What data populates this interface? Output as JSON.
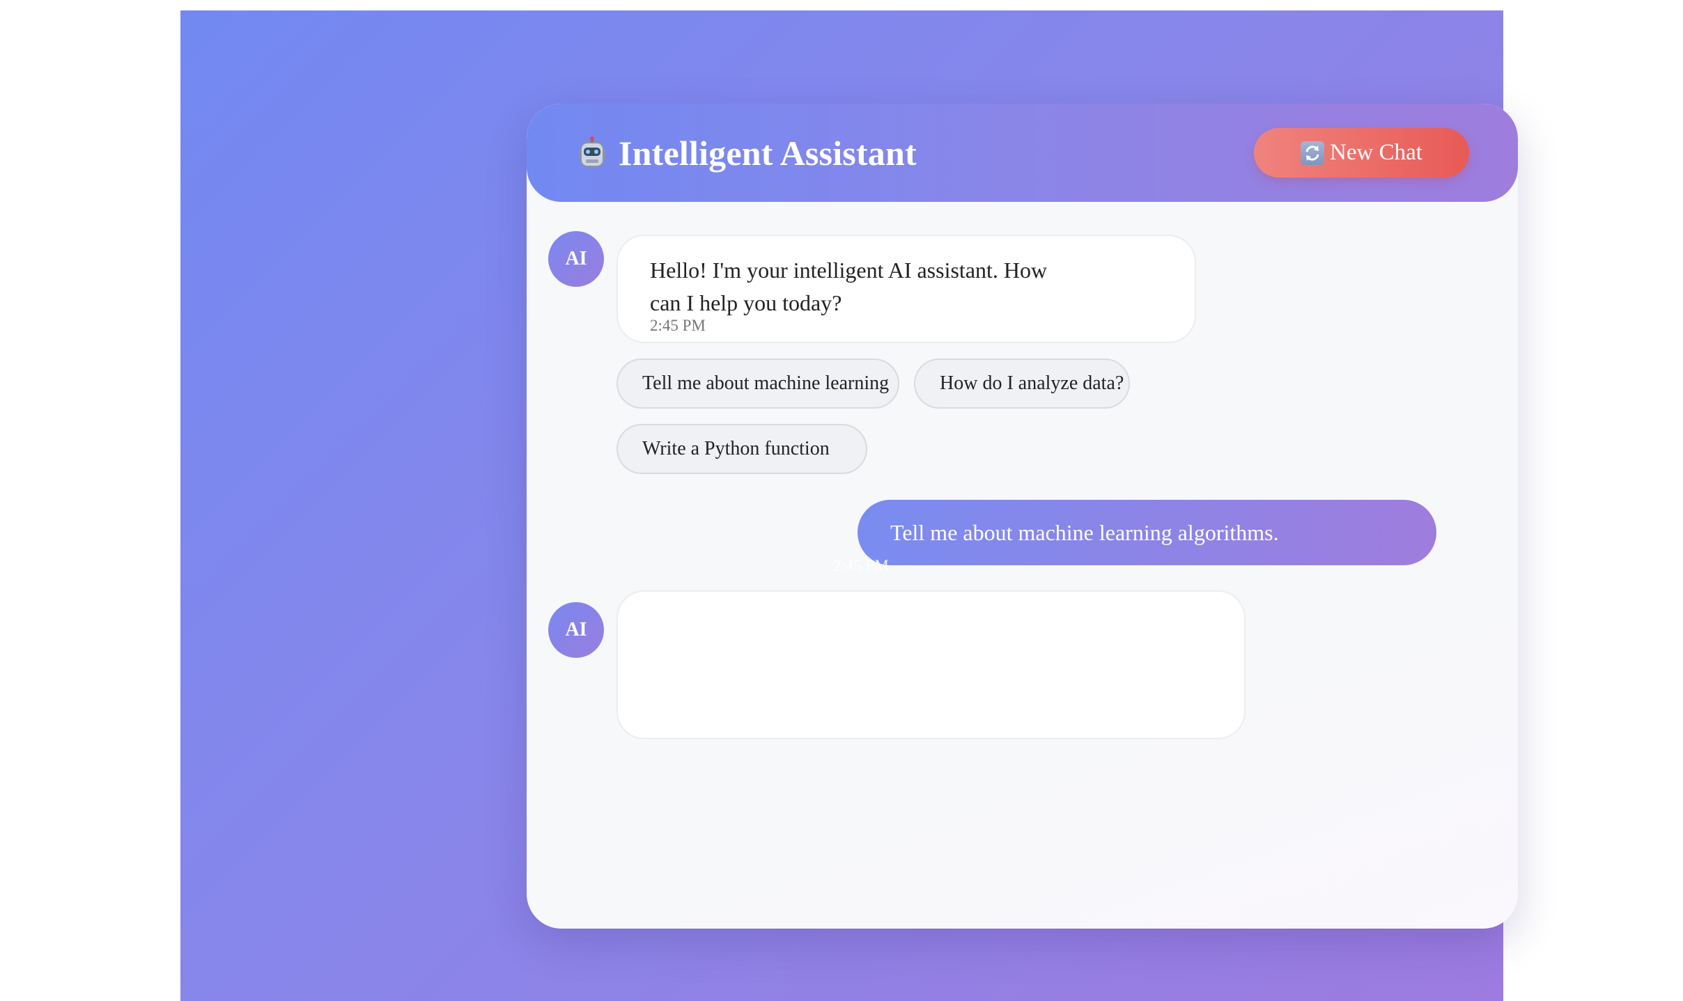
{
  "header": {
    "icon": "robot-icon",
    "title": "Intelligent Assistant",
    "new_chat_icon": "refresh-icon",
    "new_chat_label": "New Chat"
  },
  "messages": [
    {
      "role": "ai",
      "avatar": "AI",
      "text": "Hello! I'm your intelligent AI assistant. How can I help you today?",
      "time": "2:45 PM"
    },
    {
      "role": "user",
      "text": "Tell me about machine learning algorithms.",
      "time": "2:45 PM"
    },
    {
      "role": "ai",
      "avatar": "AI",
      "text": "",
      "time": ""
    }
  ],
  "suggestions": [
    "Tell me about machine learning",
    "How do I analyze data?",
    "Write a Python function"
  ],
  "colors": {
    "accent_start": "#7289f2",
    "accent_end": "#9e7ddd",
    "new_chat_start": "#f0837e",
    "new_chat_end": "#e85a56"
  }
}
